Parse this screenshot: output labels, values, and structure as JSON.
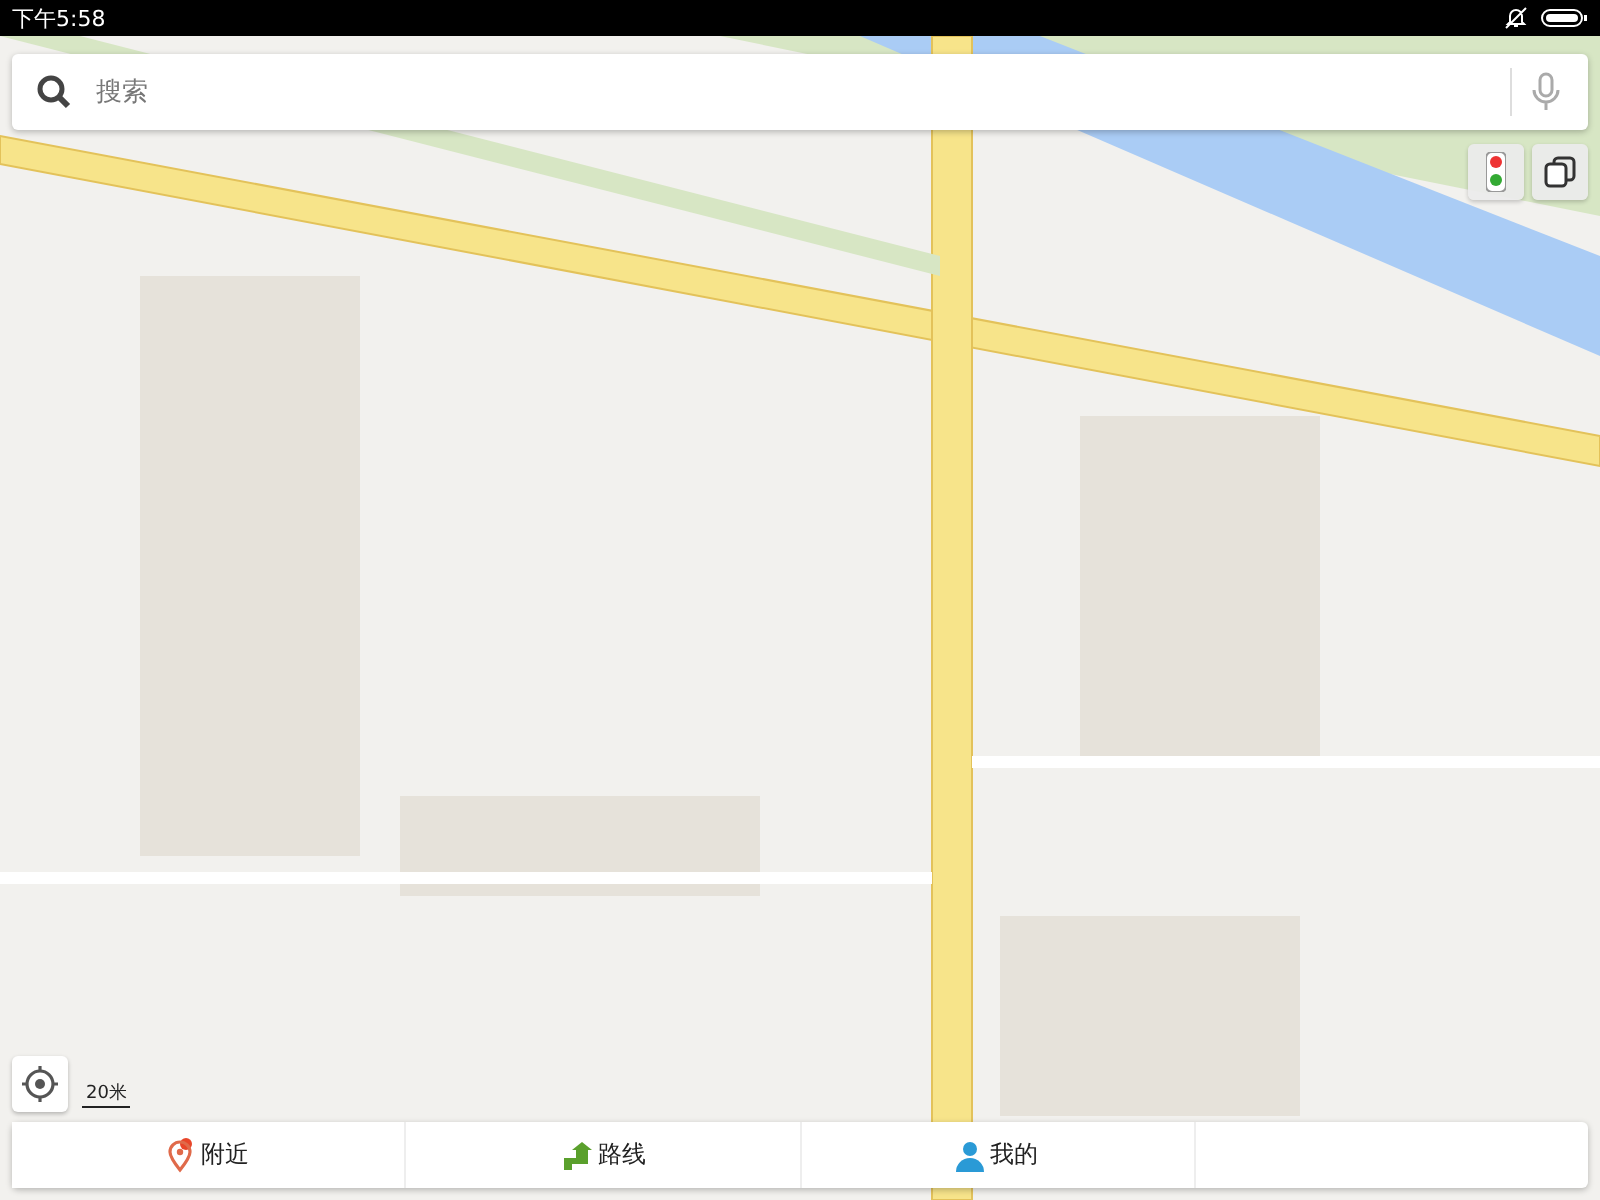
{
  "status_bar": {
    "time": "下午5:58"
  },
  "search": {
    "placeholder": "搜索"
  },
  "map": {
    "scale": "20米"
  },
  "bottom_nav": [
    {
      "label": "附近",
      "kind": "nearby"
    },
    {
      "label": "路线",
      "kind": "route"
    },
    {
      "label": "我的",
      "kind": "mine"
    }
  ]
}
